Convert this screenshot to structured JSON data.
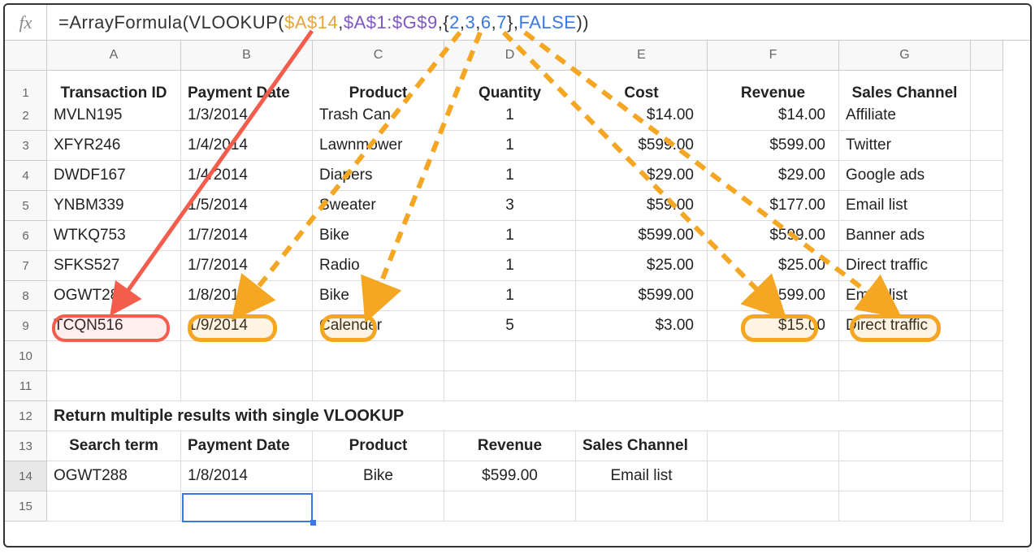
{
  "formula": {
    "prefix": "=ArrayFormula(VLOOKUP(",
    "arg1": "$A$14",
    "comma1": ",",
    "arg2": "$A$1:$G$9",
    "comma2": ",{",
    "n1": "2",
    "c3": ",",
    "n2": "3",
    "c4": ",",
    "n3": "6",
    "c5": ",",
    "n4": "7",
    "close1": "},",
    "arg_false": "FALSE",
    "suffix": "))"
  },
  "colHeads": [
    "A",
    "B",
    "C",
    "D",
    "E",
    "F",
    "G",
    ""
  ],
  "rowHeads": [
    "1",
    "2",
    "3",
    "4",
    "5",
    "6",
    "7",
    "8",
    "9",
    "10",
    "11",
    "12",
    "13",
    "14",
    "15"
  ],
  "headers": {
    "r1": [
      "Transaction ID",
      "Payment Date",
      "Product",
      "Quantity",
      "Cost",
      "Revenue",
      "Sales Channel"
    ]
  },
  "rows": {
    "r2": {
      "id": "MVLN195",
      "date": "1/3/2014",
      "prod": "Trash Can",
      "qty": "1",
      "cost": "$14.00",
      "rev": "$14.00",
      "ch": "Affiliate"
    },
    "r3": {
      "id": "XFYR246",
      "date": "1/4/2014",
      "prod": "Lawnmower",
      "qty": "1",
      "cost": "$599.00",
      "rev": "$599.00",
      "ch": "Twitter"
    },
    "r4": {
      "id": "DWDF167",
      "date": "1/4/2014",
      "prod": "Diapers",
      "qty": "1",
      "cost": "$29.00",
      "rev": "$29.00",
      "ch": "Google ads"
    },
    "r5": {
      "id": "YNBM339",
      "date": "1/5/2014",
      "prod": "Sweater",
      "qty": "3",
      "cost": "$59.00",
      "rev": "$177.00",
      "ch": "Email list"
    },
    "r6": {
      "id": "WTKQ753",
      "date": "1/7/2014",
      "prod": "Bike",
      "qty": "1",
      "cost": "$599.00",
      "rev": "$599.00",
      "ch": "Banner ads"
    },
    "r7": {
      "id": "SFKS527",
      "date": "1/7/2014",
      "prod": "Radio",
      "qty": "1",
      "cost": "$25.00",
      "rev": "$25.00",
      "ch": "Direct traffic"
    },
    "r8": {
      "id": "OGWT288",
      "date": "1/8/2014",
      "prod": "Bike",
      "qty": "1",
      "cost": "$599.00",
      "rev": "$599.00",
      "ch": "Email list"
    },
    "r9": {
      "id": "TCQN516",
      "date": "1/9/2014",
      "prod": "Calender",
      "qty": "5",
      "cost": "$3.00",
      "rev": "$15.00",
      "ch": "Direct traffic"
    }
  },
  "section": {
    "title": "Return multiple results with single VLOOKUP",
    "labels": [
      "Search term",
      "Payment Date",
      "Product",
      "Revenue",
      "Sales Channel"
    ],
    "result": {
      "term": "OGWT288",
      "date": "1/8/2014",
      "prod": "Bike",
      "rev": "$599.00",
      "ch": "Email list"
    }
  }
}
